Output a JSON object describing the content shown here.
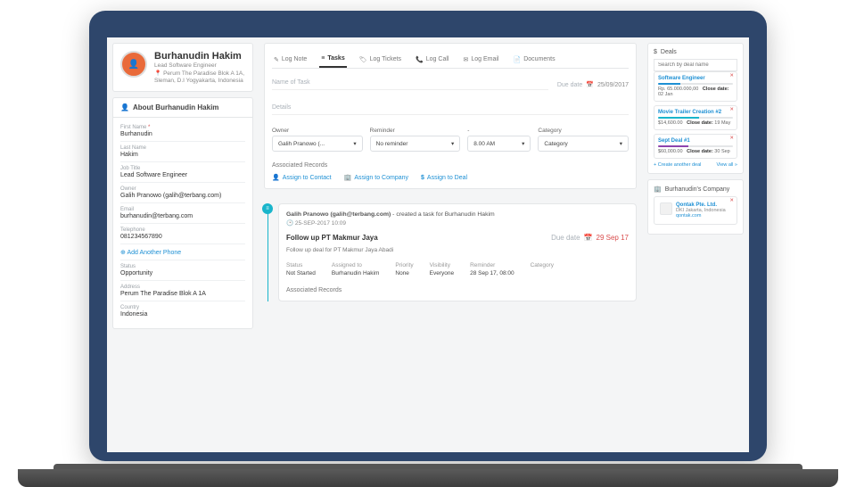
{
  "profile": {
    "name": "Burhanudin Hakim",
    "title": "Lead Software Engineer",
    "address1": "Perum The Paradise Blok A 1A,",
    "address2": "Sleman, D.I Yogyakarta, Indonesia"
  },
  "about": {
    "heading": "About Burhanudin Hakim",
    "first_name_label": "First Name",
    "first_name": "Burhanudin",
    "last_name_label": "Last Name",
    "last_name": "Hakim",
    "job_title_label": "Job Title",
    "job_title": "Lead Software Engineer",
    "owner_label": "Owner",
    "owner": "Galih Pranowo (galih@terbang.com)",
    "email_label": "Email",
    "email": "burhanudin@terbang.com",
    "telephone_label": "Telephone",
    "telephone": "081234567890",
    "add_phone": "Add Another Phone",
    "status_label": "Status",
    "status": "Opportunity",
    "address_label": "Address",
    "address": "Perum The Paradise Blok A 1A",
    "country_label": "Country",
    "country": "Indonesia"
  },
  "tabs": {
    "log_note": "Log Note",
    "tasks": "Tasks",
    "log_tickets": "Log Tickets",
    "log_call": "Log Call",
    "log_email": "Log Email",
    "documents": "Documents"
  },
  "taskform": {
    "name_ph": "Name of Task",
    "due_label": "Due date",
    "due_value": "25/09/2017",
    "details_ph": "Details",
    "owner_label": "Owner",
    "owner_value": "Galih Pranowo (...",
    "reminder_label": "Reminder",
    "reminder_value": "No reminder",
    "time_label": "-",
    "time_value": "8.00 AM",
    "category_label": "Category",
    "category_value": "Category",
    "assoc_label": "Associated Records",
    "assign_contact": "Assign to Contact",
    "assign_company": "Assign to Company",
    "assign_deal": "Assign to Deal"
  },
  "timeline": {
    "actor": "Galih Pranowo (galih@terbang.com)",
    "action": " - created a task for Burhanudin Hakim",
    "timestamp": "25-SEP-2017 10:09",
    "title": "Follow up PT Makmur Jaya",
    "due_label": "Due date",
    "due_value": "29 Sep 17",
    "desc": "Follow up deal for PT Makmur Jaya Abadi",
    "cols": {
      "status_h": "Status",
      "status_v": "Not Started",
      "assigned_h": "Assigned to",
      "assigned_v": "Burhanudin Hakim",
      "priority_h": "Priority",
      "priority_v": "None",
      "visibility_h": "Visibility",
      "visibility_v": "Everyone",
      "reminder_h": "Reminder",
      "reminder_v": "28 Sep 17, 08:00",
      "category_h": "Category",
      "category_v": ""
    },
    "assoc_label": "Associated Records"
  },
  "deals": {
    "heading": "Deals",
    "search_ph": "Search by deal name",
    "items": [
      {
        "name": "Software Engineer",
        "amount": "Rp. 65.000.000,00",
        "close": "02 Jan",
        "bar_color": "#1e90d4",
        "bar_w": "30%"
      },
      {
        "name": "Movie Trailer Creation #2",
        "amount": "$14,600.00",
        "close": "19 May",
        "bar_color": "#19b5cb",
        "bar_w": "55%"
      },
      {
        "name": "Sept Deal #1",
        "amount": "$60,000.00",
        "close": "30 Sep",
        "bar_color": "#8e44ad",
        "bar_w": "40%"
      }
    ],
    "create": "Create another deal",
    "view_all": "View all »",
    "close_label": "Close date:"
  },
  "company": {
    "heading": "Burhanudin's Company",
    "name": "Qontak Pte. Ltd.",
    "sub": "DKI Jakarta, Indonesia",
    "link": "qontak.com"
  }
}
